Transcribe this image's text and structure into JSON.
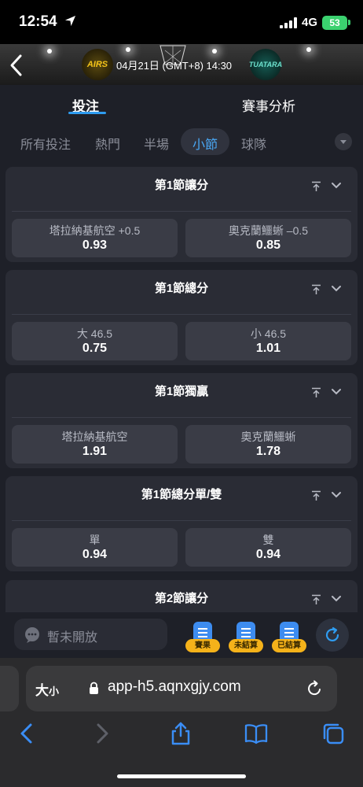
{
  "status_bar": {
    "time": "12:54",
    "network": "4G",
    "battery": "53"
  },
  "match": {
    "home_logo_text": "AIRS",
    "away_logo_text": "TUATARA",
    "datetime": "04月21日 (GMT+8)  14:30"
  },
  "main_tabs": [
    {
      "label": "投注",
      "active": true
    },
    {
      "label": "賽事分析",
      "active": false
    }
  ],
  "sub_tabs": [
    {
      "label": "所有投注"
    },
    {
      "label": "熱門"
    },
    {
      "label": "半場"
    },
    {
      "label": "小節",
      "active": true
    },
    {
      "label": "球隊"
    }
  ],
  "markets": [
    {
      "title": "第1節讓分",
      "options": [
        {
          "name": "塔拉納基航空 +0.5",
          "odds": "0.93"
        },
        {
          "name": "奧克蘭鱷蜥 –0.5",
          "odds": "0.85"
        }
      ]
    },
    {
      "title": "第1節總分",
      "options": [
        {
          "name": "大 46.5",
          "odds": "0.75"
        },
        {
          "name": "小 46.5",
          "odds": "1.01"
        }
      ]
    },
    {
      "title": "第1節獨贏",
      "options": [
        {
          "name": "塔拉納基航空",
          "odds": "1.91"
        },
        {
          "name": "奧克蘭鱷蜥",
          "odds": "1.78"
        }
      ]
    },
    {
      "title": "第1節總分單/雙",
      "options": [
        {
          "name": "單",
          "odds": "0.94"
        },
        {
          "name": "雙",
          "odds": "0.94"
        }
      ]
    },
    {
      "title": "第2節讓分",
      "options": []
    }
  ],
  "bottom_tools": {
    "chat_placeholder": "暫未開放",
    "tools": [
      {
        "label": "賽果"
      },
      {
        "label": "未結算"
      },
      {
        "label": "已結算"
      }
    ]
  },
  "browser": {
    "text_size_big": "大",
    "text_size_small": "小",
    "url": "app-h5.aqnxgjy.com"
  },
  "colors": {
    "accent": "#2f9cf0",
    "background": "#1e2028",
    "card": "#2a2c35",
    "odd_button": "#3a3c46",
    "badge": "#f5b21a"
  }
}
